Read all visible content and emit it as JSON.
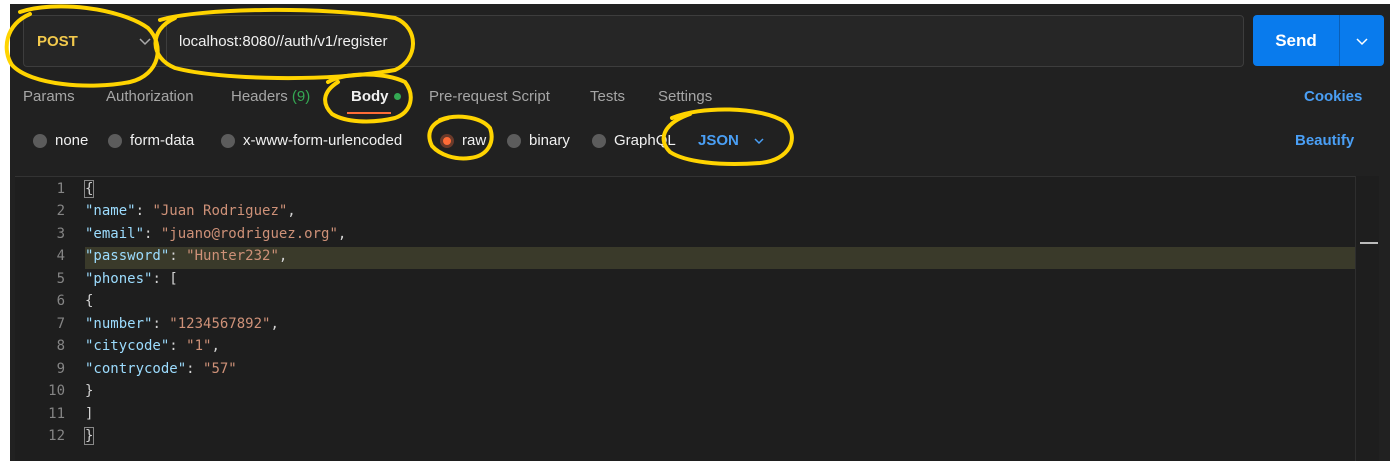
{
  "request": {
    "method": "POST",
    "url": "localhost:8080//auth/v1/register",
    "send_label": "Send"
  },
  "tabs": [
    {
      "label": "Params"
    },
    {
      "label": "Authorization"
    },
    {
      "label": "Headers",
      "count": "(9)"
    },
    {
      "label": "Body"
    },
    {
      "label": "Pre-request Script"
    },
    {
      "label": "Tests"
    },
    {
      "label": "Settings"
    }
  ],
  "active_tab": "Body",
  "cookies_label": "Cookies",
  "body_types": [
    {
      "label": "none"
    },
    {
      "label": "form-data"
    },
    {
      "label": "x-www-form-urlencoded"
    },
    {
      "label": "raw"
    },
    {
      "label": "binary"
    },
    {
      "label": "GraphQL"
    }
  ],
  "selected_body_type": "raw",
  "format_label": "JSON",
  "beautify_label": "Beautify",
  "line_numbers": [
    "1",
    "2",
    "3",
    "4",
    "5",
    "6",
    "7",
    "8",
    "9",
    "10",
    "11",
    "12"
  ],
  "code": {
    "open_brace": "{",
    "name_key": "\"name\"",
    "name_val": "\"Juan Rodriguez\"",
    "email_key": "\"email\"",
    "email_val": "\"juano@rodriguez.org\"",
    "password_key": "\"password\"",
    "password_val": "\"Hunter232\"",
    "phones_key": "\"phones\"",
    "open_bracket": "[",
    "open_brace_inner": "{",
    "number_key": "\"number\"",
    "number_val": "\"1234567892\"",
    "citycode_key": "\"citycode\"",
    "citycode_val": "\"1\"",
    "contrycode_key": "\"contrycode\"",
    "contrycode_val": "\"57\"",
    "close_brace_inner": "}",
    "close_bracket": "]",
    "close_brace": "}"
  },
  "colors": {
    "accent": "#ff6c37",
    "send_button": "#097bed",
    "method": "#f2c94c",
    "annotation": "#ffd400"
  }
}
